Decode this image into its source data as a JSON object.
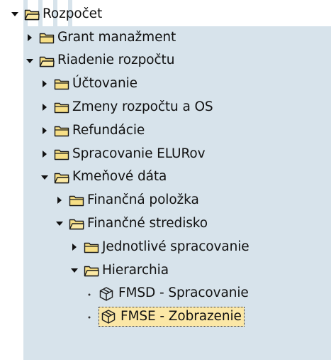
{
  "tree": [
    {
      "label": "Rozpočet",
      "level": 0,
      "type": "folder",
      "state": "expanded"
    },
    {
      "label": "Grant manažment",
      "level": 1,
      "type": "folder",
      "state": "collapsed"
    },
    {
      "label": "Riadenie rozpočtu",
      "level": 1,
      "type": "folder",
      "state": "expanded"
    },
    {
      "label": "Účtovanie",
      "level": 2,
      "type": "folder",
      "state": "collapsed"
    },
    {
      "label": "Zmeny rozpočtu a OS",
      "level": 2,
      "type": "folder",
      "state": "collapsed"
    },
    {
      "label": "Refundácie",
      "level": 2,
      "type": "folder",
      "state": "collapsed"
    },
    {
      "label": "Spracovanie ELURov",
      "level": 2,
      "type": "folder",
      "state": "collapsed"
    },
    {
      "label": "Kmeňové dáta",
      "level": 2,
      "type": "folder",
      "state": "expanded"
    },
    {
      "label": "Finančná položka",
      "level": 3,
      "type": "folder",
      "state": "collapsed"
    },
    {
      "label": "Finančné stredisko",
      "level": 3,
      "type": "folder",
      "state": "expanded"
    },
    {
      "label": "Jednotlivé spracovanie",
      "level": 4,
      "type": "folder",
      "state": "collapsed"
    },
    {
      "label": "Hierarchia",
      "level": 4,
      "type": "folder",
      "state": "expanded"
    },
    {
      "label": "FMSD - Spracovanie",
      "level": 5,
      "type": "transaction",
      "state": "leaf"
    },
    {
      "label": "FMSE - Zobrazenie",
      "level": 5,
      "type": "transaction",
      "state": "leaf",
      "selected": true
    }
  ],
  "colors": {
    "band": "#d7e3eb",
    "folder_fill": "#f7df86",
    "folder_stroke": "#1a1a1a",
    "selection": "#fbe7a6",
    "text": "#111111"
  }
}
